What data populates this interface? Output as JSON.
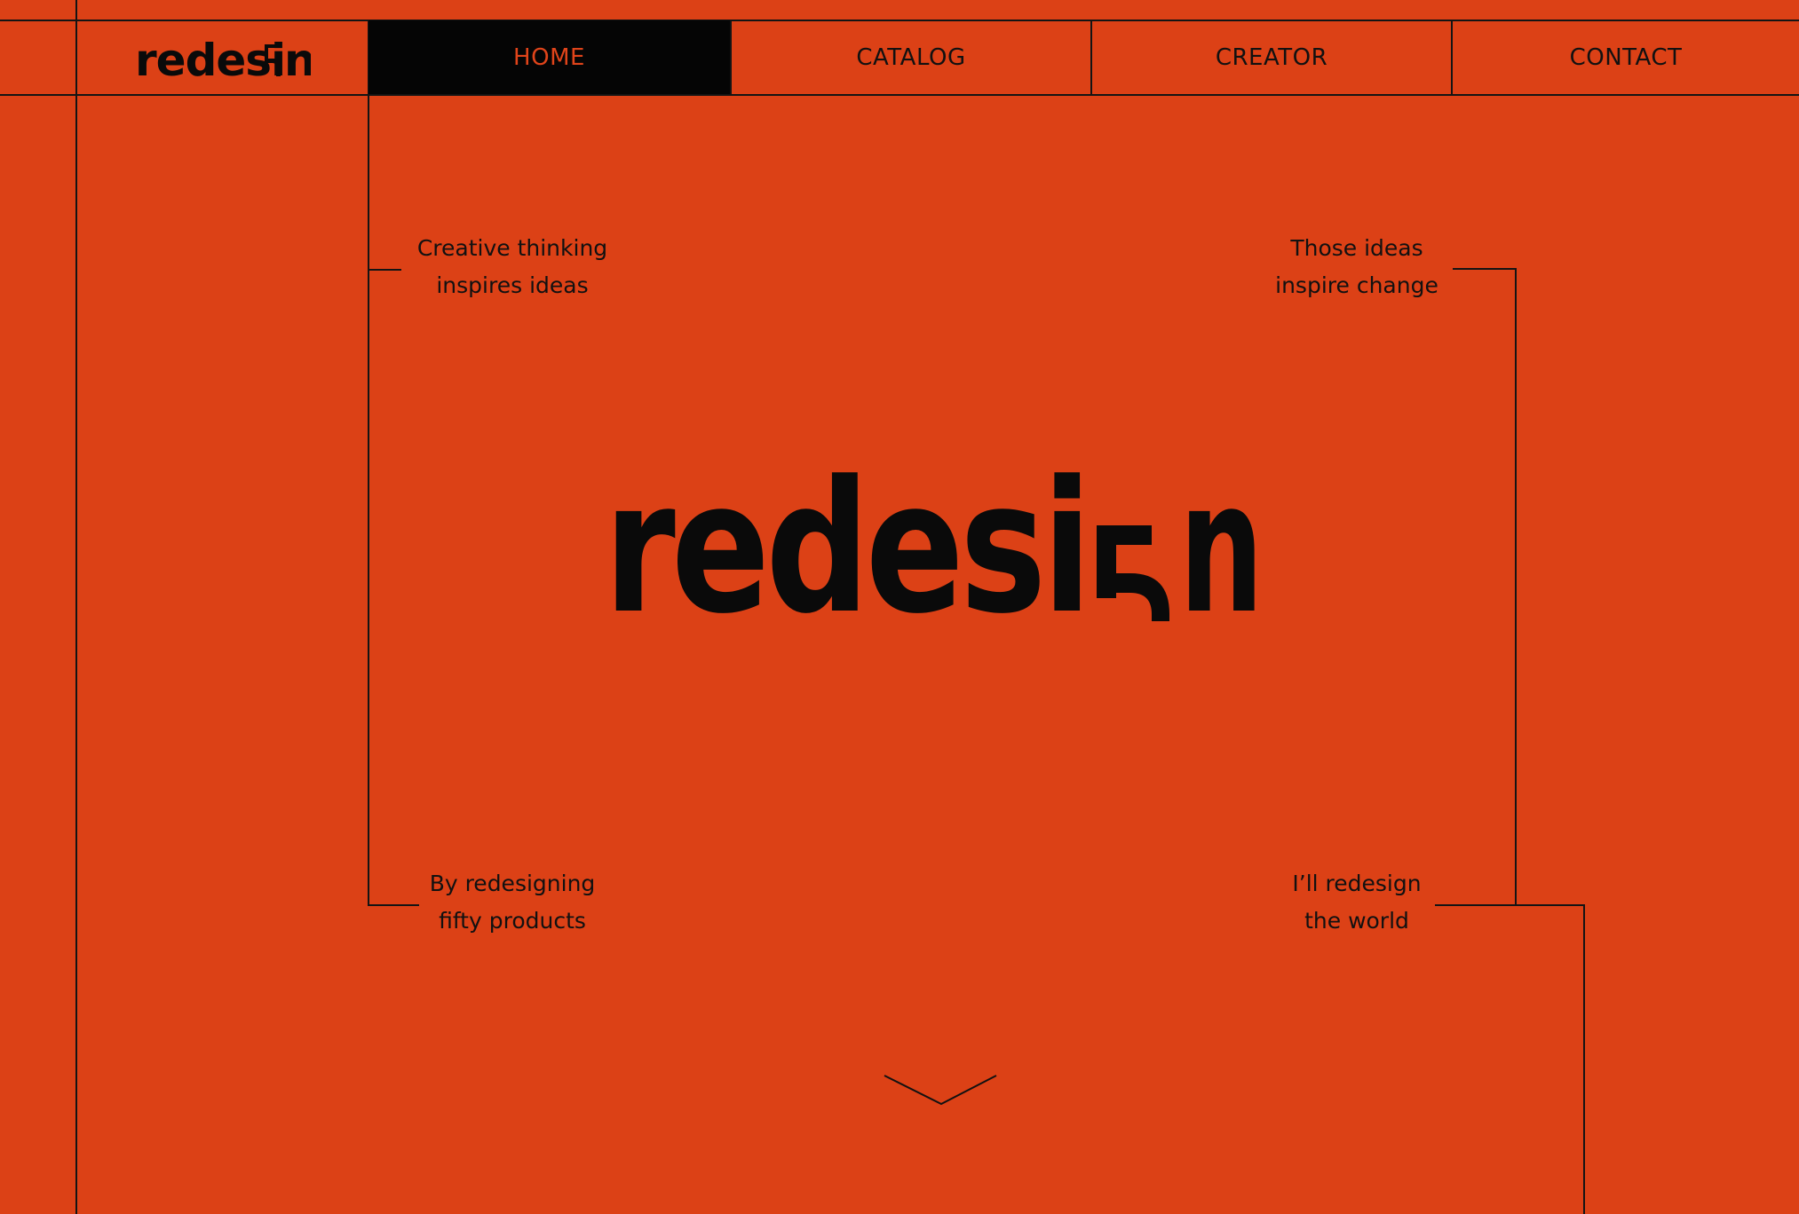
{
  "brand": {
    "name": "redesign",
    "glyphs_before": "redesi",
    "glyphs_after": "n"
  },
  "nav": {
    "items": [
      {
        "label": "HOME",
        "active": true
      },
      {
        "label": "CATALOG",
        "active": false
      },
      {
        "label": "CREATOR",
        "active": false
      },
      {
        "label": "CONTACT",
        "active": false
      }
    ]
  },
  "hero": {
    "wordmark_before": "redesi",
    "wordmark_after": "n",
    "quotes": {
      "top_left": [
        "Creative thinking",
        "inspires ideas"
      ],
      "top_right": [
        "Those ideas",
        "inspire change"
      ],
      "bottom_left": [
        "By redesigning",
        "fifty products"
      ],
      "bottom_right": [
        "I’ll redesign",
        "the world"
      ]
    },
    "scroll_icon": "chevron-down-icon"
  },
  "colors": {
    "background": "#DC4116",
    "ink": "#111111",
    "active_nav_bg": "#050505",
    "active_nav_text": "#E0441A"
  }
}
